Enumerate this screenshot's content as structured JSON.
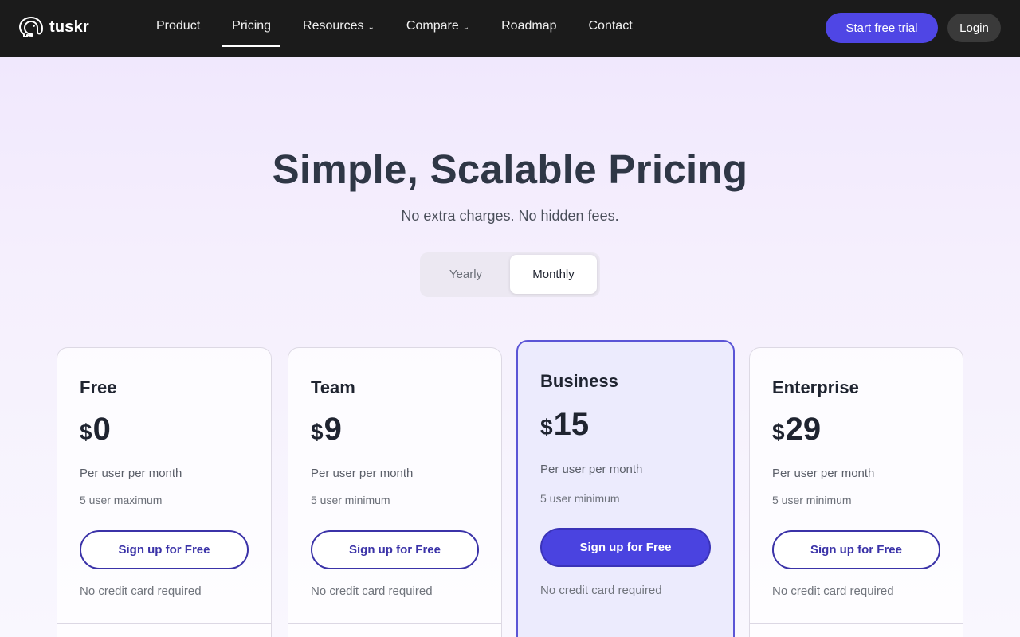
{
  "nav": {
    "brand": "tuskr",
    "links": [
      {
        "label": "Product",
        "has_dropdown": false,
        "active": false
      },
      {
        "label": "Pricing",
        "has_dropdown": false,
        "active": true
      },
      {
        "label": "Resources",
        "has_dropdown": true,
        "active": false
      },
      {
        "label": "Compare",
        "has_dropdown": true,
        "active": false
      },
      {
        "label": "Roadmap",
        "has_dropdown": false,
        "active": false
      },
      {
        "label": "Contact",
        "has_dropdown": false,
        "active": false
      }
    ],
    "dropdown_glyph": "⌄",
    "trial_button": "Start free trial",
    "login_button": "Login"
  },
  "hero": {
    "title": "Simple, Scalable Pricing",
    "subtitle": "No extra charges. No hidden fees."
  },
  "billing_toggle": {
    "options": [
      "Yearly",
      "Monthly"
    ],
    "selected": "Monthly"
  },
  "plans": [
    {
      "name": "Free",
      "currency": "$",
      "price": "0",
      "per": "Per user per month",
      "limit": "5 user maximum",
      "cta": "Sign up for Free",
      "note": "No credit card required",
      "featured": false
    },
    {
      "name": "Team",
      "currency": "$",
      "price": "9",
      "per": "Per user per month",
      "limit": "5 user minimum",
      "cta": "Sign up for Free",
      "note": "No credit card required",
      "featured": false
    },
    {
      "name": "Business",
      "currency": "$",
      "price": "15",
      "per": "Per user per month",
      "limit": "5 user minimum",
      "cta": "Sign up for Free",
      "note": "No credit card required",
      "featured": true
    },
    {
      "name": "Enterprise",
      "currency": "$",
      "price": "29",
      "per": "Per user per month",
      "limit": "5 user minimum",
      "cta": "Sign up for Free",
      "note": "No credit card required",
      "featured": false
    }
  ],
  "colors": {
    "nav_bg": "#1b1b1b",
    "accent": "#4f46e5",
    "button_border": "#3b33a8",
    "featured_bg": "#ecebfd"
  },
  "icons": {
    "brand_logo": "elephant-logo-icon",
    "dropdown": "chevron-down-icon"
  }
}
